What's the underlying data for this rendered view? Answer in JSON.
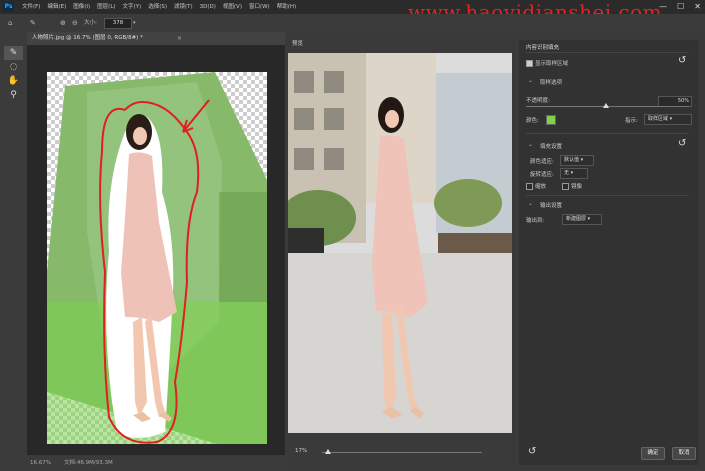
{
  "menu": {
    "logo": "Ps",
    "items": [
      "文件(F)",
      "编辑(E)",
      "图像(I)",
      "图层(L)",
      "文字(Y)",
      "选择(S)",
      "滤镜(T)",
      "3D(D)",
      "视图(V)",
      "窗口(W)",
      "帮助(H)"
    ],
    "minimize": "—",
    "maximize": "☐",
    "close": "✕"
  },
  "watermark": "www.haoyidianshej.com",
  "options": {
    "size_label": "大小:",
    "size_value": "378"
  },
  "document": {
    "tab_title": "人物照片.jpg @ 16.7% (图层 0, RGB/8#) *",
    "tab_close": "×",
    "zoom": "16.67%",
    "doc_info": "文档:46.9M/93.3M"
  },
  "preview": {
    "title": "预览",
    "zoom": "17%"
  },
  "panel": {
    "title": "内容识别填充",
    "show_sampling_area": "显示取样区域",
    "sampling_section": "取样选项",
    "opacity_label": "不透明度:",
    "opacity_value": "50%",
    "color_label": "颜色:",
    "indicates_label": "指示:",
    "indicates_value": "取样区域",
    "fill_section": "填充设置",
    "color_adapt_label": "颜色适应:",
    "color_adapt_value": "默认值",
    "rotation_adapt_label": "旋转适应:",
    "rotation_adapt_value": "无",
    "scale_label": "缩放",
    "mirror_label": "镜像",
    "output_section": "输出设置",
    "output_to_label": "输出到:",
    "output_to_value": "新建图层",
    "ok_button": "确定",
    "cancel_button": "取消"
  },
  "colors": {
    "sampling_overlay": "#7cd34a",
    "annotation_red": "#e02020",
    "watermark_red": "#e82020"
  }
}
